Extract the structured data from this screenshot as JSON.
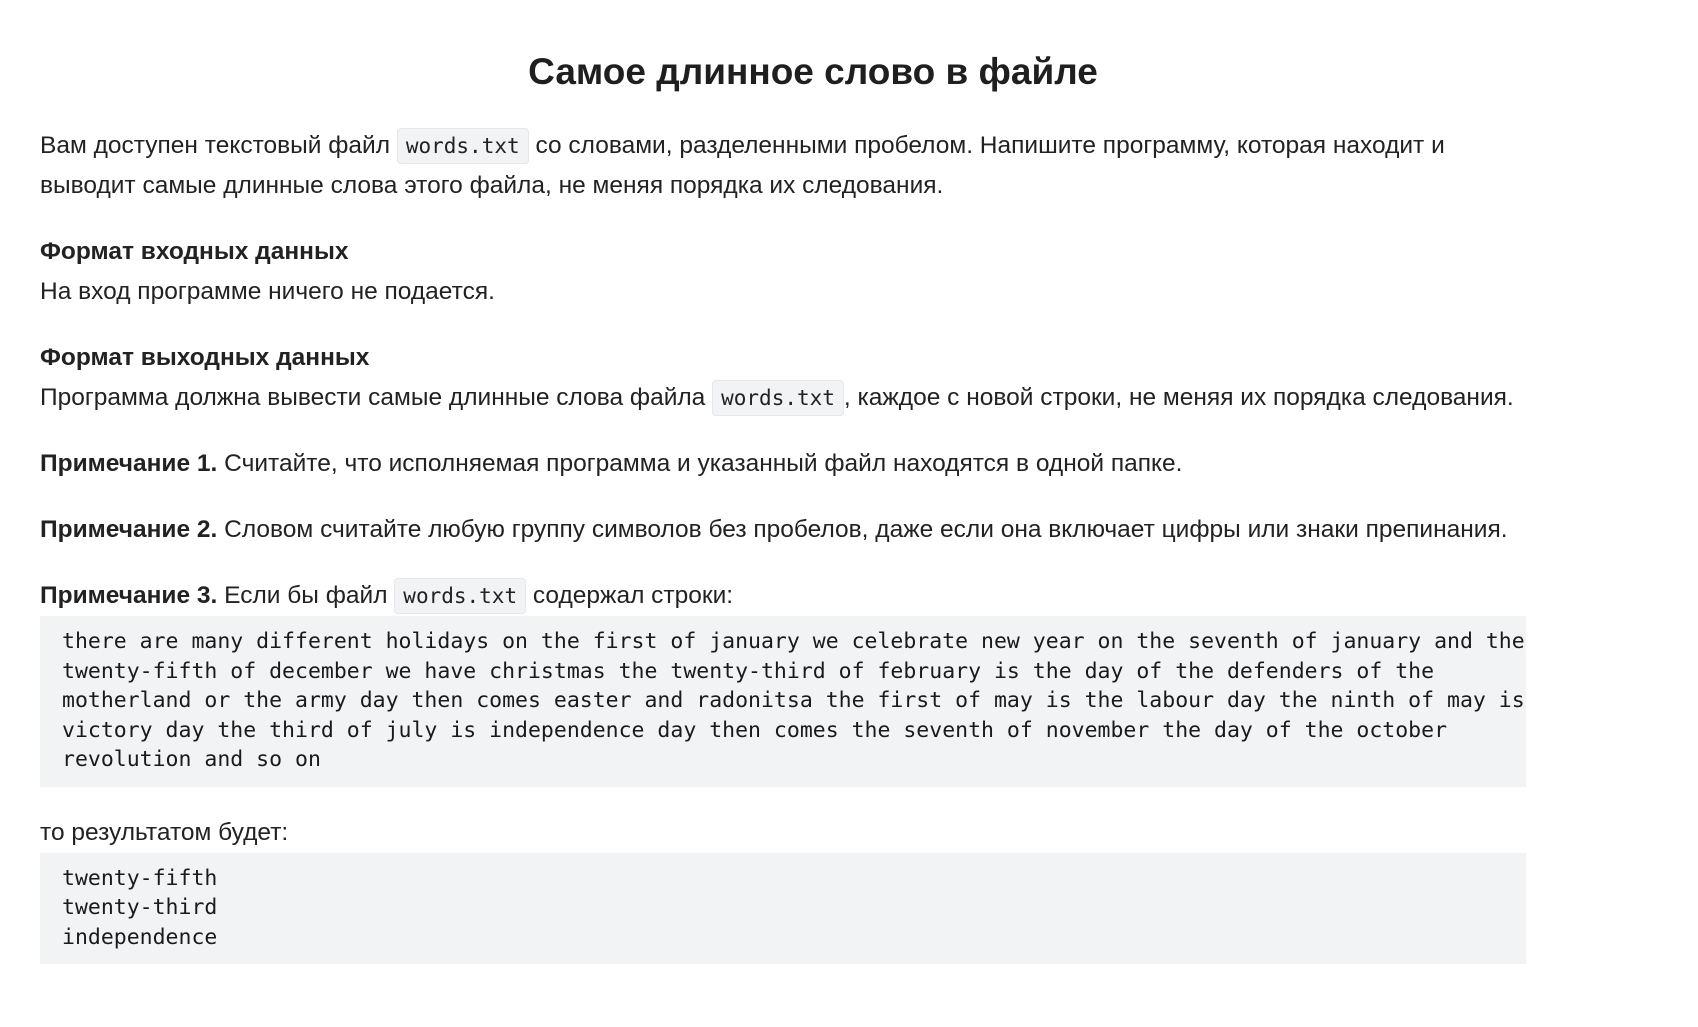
{
  "title": "Самое длинное слово в файле",
  "intro": {
    "before": "Вам доступен текстовый файл ",
    "code": "words.txt",
    "after": " со словами, разделенными пробелом. Напишите программу, которая находит и выводит самые длинные слова этого файла, не меняя порядка их следования."
  },
  "input_format": {
    "heading": "Формат входных данных",
    "text": "На вход программе ничего не подается."
  },
  "output_format": {
    "heading": "Формат выходных данных",
    "before": "Программа должна вывести самые длинные слова файла ",
    "code": "words.txt",
    "after": ", каждое с новой строки, не меняя их порядка следования."
  },
  "notes": [
    {
      "label": "Примечание 1.",
      "text": " Считайте, что исполняемая программа и указанный файл находятся в одной папке."
    },
    {
      "label": "Примечание 2.",
      "text": " Словом считайте любую группу символов без пробелов, даже если она включает цифры или знаки препинания."
    },
    {
      "label": "Примечание 3.",
      "before": " Если бы файл ",
      "code": "words.txt",
      "after": " содержал строки:"
    }
  ],
  "example_input": "there are many different holidays on the first of january we celebrate new year on the seventh of january and the\ntwenty-fifth of december we have christmas the twenty-third of february is the day of the defenders of the\nmotherland or the army day then comes easter and radonitsa the first of may is the labour day the ninth of may is\nvictory day the third of july is independence day then comes the seventh of november the day of the october\nrevolution and so on",
  "result_label": "то результатом будет:",
  "example_output": "twenty-fifth\ntwenty-third\nindependence"
}
